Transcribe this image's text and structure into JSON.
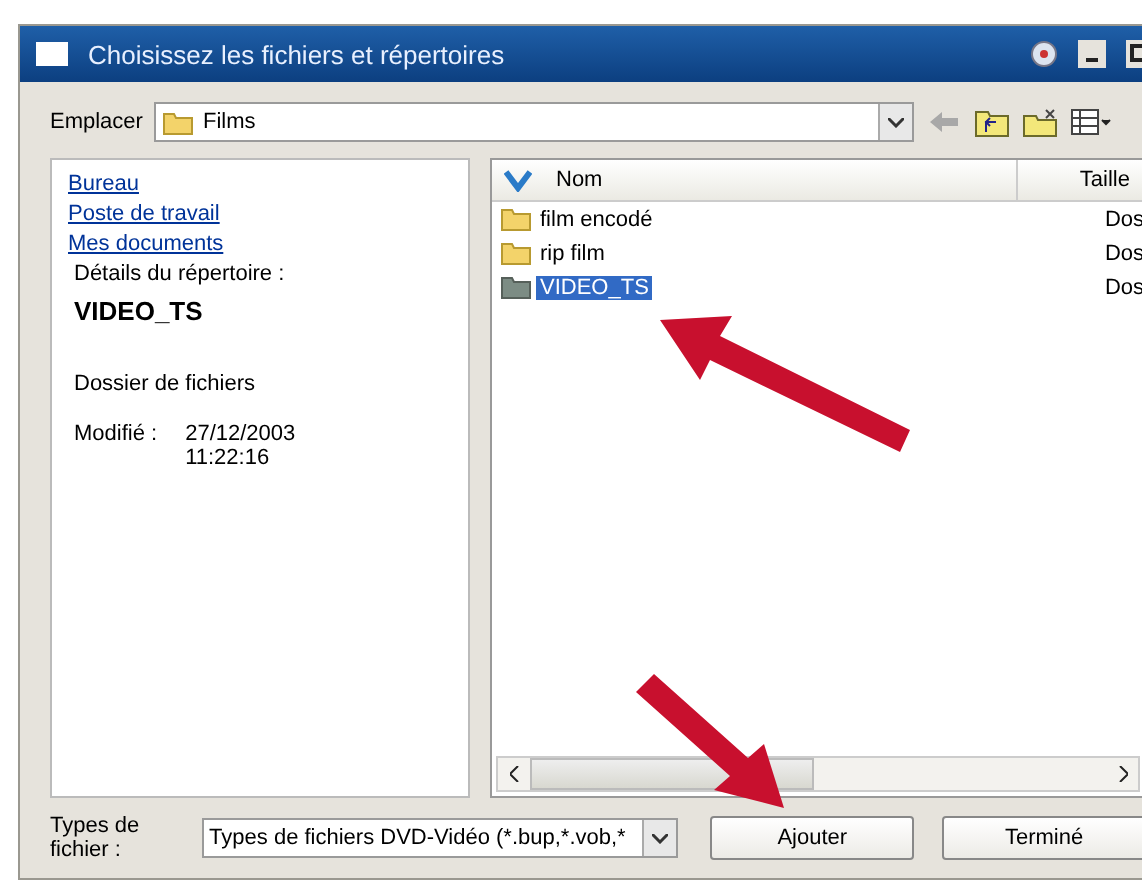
{
  "window": {
    "title": "Choisissez les fichiers et répertoires"
  },
  "location": {
    "label": "Emplacer",
    "value": "Films"
  },
  "places": [
    {
      "label": "Bureau"
    },
    {
      "label": "Poste de travail"
    },
    {
      "label": "Mes documents"
    }
  ],
  "details": {
    "heading": "Détails du répertoire :",
    "name": "VIDEO_TS",
    "type": "Dossier de fichiers",
    "modified_label": "Modifié :",
    "modified_lines": [
      "27/12/2003",
      "11:22:16"
    ]
  },
  "table": {
    "columns": [
      "Nom",
      "Taille"
    ],
    "rows": [
      {
        "name": "film encodé",
        "column_3": "Dos",
        "selected": false,
        "kind": "folder"
      },
      {
        "name": "rip film",
        "column_3": "Dos",
        "selected": false,
        "kind": "folder"
      },
      {
        "name": "VIDEO_TS",
        "column_3": "Dos",
        "selected": true,
        "kind": "dvd"
      }
    ]
  },
  "file_type": {
    "label": "Types de fichier :",
    "value": "Types de fichiers DVD-Vidéo (*.bup,*.vob,*"
  },
  "buttons": [
    "Ajouter",
    "Terminé"
  ]
}
